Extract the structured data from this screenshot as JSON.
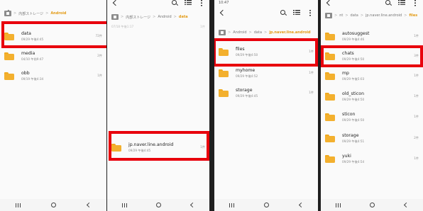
{
  "panels": [
    {
      "status": {
        "left": "",
        "right": ""
      },
      "breadcrumb": [
        "内部ストレージ",
        "Android"
      ],
      "items": [
        {
          "name": "data",
          "date": "09/29 午後4:45",
          "count": "72件"
        },
        {
          "name": "media",
          "date": "04/10 午前9:47",
          "count": "2件"
        },
        {
          "name": "obb",
          "date": "09/19 午後4:34",
          "count": "1件"
        }
      ]
    },
    {
      "status": {
        "left": "",
        "right": ""
      },
      "breadcrumb": [
        "内部ストレージ",
        "Android",
        "data"
      ],
      "items": [
        {
          "name": "",
          "date": "07/18 午後1:17",
          "count": "1件"
        },
        {
          "name": "jp.naver.line.android",
          "date": "09/29 午後4:45",
          "count": "1件"
        }
      ]
    },
    {
      "status": {
        "left": "10:47",
        "right": ""
      },
      "breadcrumb": [
        "Android",
        "data",
        "jp.naver.line.android"
      ],
      "items": [
        {
          "name": "files",
          "date": "09/29 午後4:50",
          "count": "1件"
        },
        {
          "name": "myhome",
          "date": "09/29 午後4:52",
          "count": "1件"
        },
        {
          "name": "storage",
          "date": "09/29 午後4:45",
          "count": "1件"
        }
      ]
    },
    {
      "status": {
        "left": "",
        "right": ""
      },
      "breadcrumb": [
        "nt",
        "data",
        "jp.naver.line.android",
        "files"
      ],
      "items": [
        {
          "name": "autosuggest",
          "date": "09/29 午後4:46",
          "count": "1件"
        },
        {
          "name": "chats",
          "date": "09/29 午後4:50",
          "count": "3件"
        },
        {
          "name": "mp",
          "date": "09/29 午後5:03",
          "count": "1件"
        },
        {
          "name": "old_sticon",
          "date": "09/29 午後4:50",
          "count": "1件"
        },
        {
          "name": "sticon",
          "date": "09/29 午後4:50",
          "count": "1件"
        },
        {
          "name": "storage",
          "date": "09/29 午後4:51",
          "count": "2件"
        },
        {
          "name": "yuki",
          "date": "09/29 午後4:54",
          "count": "1件"
        }
      ]
    }
  ],
  "colors": {
    "highlight": "#e8000c",
    "folder": "#f3b02e",
    "crumb_active": "#e39b16"
  },
  "icons": [
    "back-icon",
    "search-icon",
    "list-view-icon",
    "more-icon",
    "home-icon",
    "folder-icon",
    "nav-recents-icon",
    "nav-home-icon",
    "nav-back-icon"
  ]
}
